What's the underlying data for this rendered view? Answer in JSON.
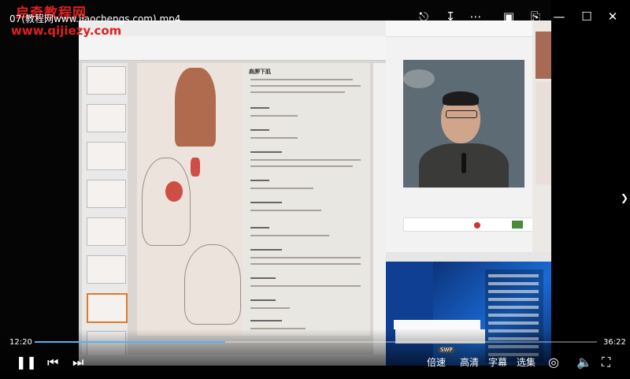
{
  "watermark": {
    "line1": "启奇教程网",
    "line2": "www.qijiezy.com"
  },
  "window": {
    "title": "07(教程网www.jiaochengs.com).mp4"
  },
  "top_icons": [
    "share-icon",
    "download-icon",
    "more-icon",
    "picture-in-picture-icon",
    "pin-icon",
    "minimize-icon",
    "maximize-icon",
    "close-icon"
  ],
  "player": {
    "current_time": "12:20",
    "total_time": "36:22",
    "progress": 0.339,
    "speed_label": "倍速",
    "quality_label": "高清",
    "subtitle_label": "字幕",
    "episodes_label": "选集",
    "swp_badge": "SWP"
  },
  "slide": {
    "heading": "肩胛下肌"
  },
  "colors": {
    "accent": "#4fb3ff",
    "watermark": "#e02020"
  }
}
